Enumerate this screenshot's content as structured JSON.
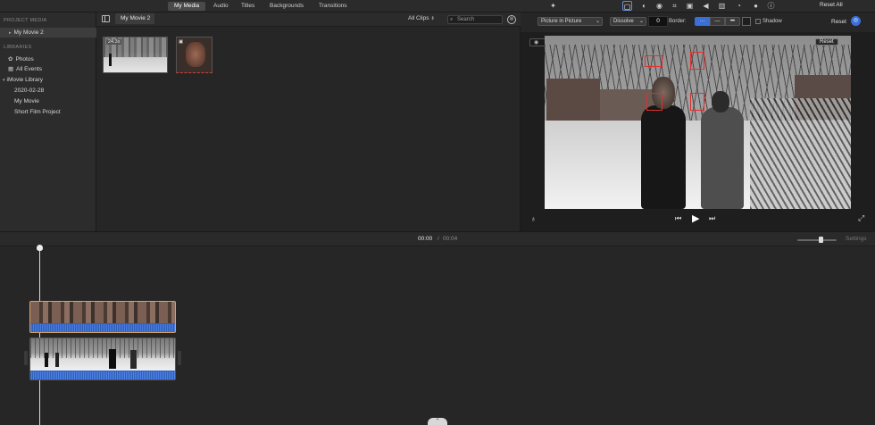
{
  "top_tabs": [
    "My Media",
    "Audio",
    "Titles",
    "Backgrounds",
    "Transitions"
  ],
  "active_tab": "My Media",
  "reset_all_label": "Reset All",
  "sidebar": {
    "project_media_heading": "PROJECT MEDIA",
    "project_item": "My Movie 2",
    "libraries_heading": "LIBRARIES",
    "library_items": [
      "Photos",
      "All Events"
    ],
    "imovie_library_label": "iMovie Library",
    "event_items": [
      "2020-02-28",
      "My Movie",
      "Short Film Project"
    ]
  },
  "browser": {
    "title": "My Movie 2",
    "filter_label": "All Clips",
    "search_placeholder": "Search",
    "clips": [
      {
        "duration_badge": "24.3s"
      },
      {
        "duration_badge": ""
      }
    ]
  },
  "viewer_toolbar": {
    "overlay_style": "Picture in Picture",
    "transition": "Dissolve",
    "transition_duration": "0",
    "border_label": "Border:",
    "shadow_label": "Shadow",
    "reset_label": "Reset"
  },
  "viewer": {
    "reset_label": "Reset"
  },
  "timeline": {
    "current_time": "00:00",
    "separator": "/",
    "total_time": "00:04",
    "settings_label": "Settings",
    "zoom_level_fraction": 0.6
  },
  "colors": {
    "accent": "#3a6fd8",
    "audio_wave": "#2f5fb8",
    "face_box": "#e03030",
    "selection_border": "#d9a460"
  }
}
